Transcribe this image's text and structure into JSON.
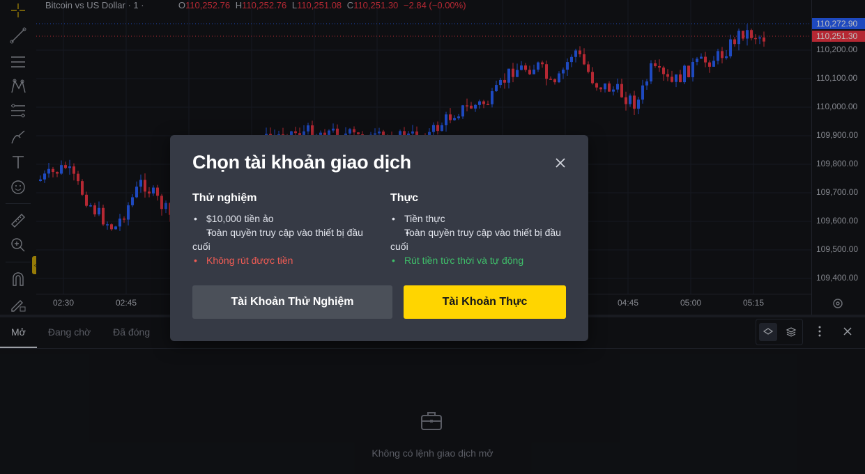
{
  "chart": {
    "symbol": "Bitcoin vs US Dollar · 1 ·",
    "ohlc": [
      {
        "key": "O",
        "value": "110,252.76"
      },
      {
        "key": "H",
        "value": "110,252.76"
      },
      {
        "key": "L",
        "value": "110,251.08"
      },
      {
        "key": "C",
        "value": "110,251.30"
      }
    ],
    "change": "−2.84 (−0.00%)",
    "price_ticks": [
      "110,200.00",
      "110,100.00",
      "110,000.00",
      "109,900.00",
      "109,800.00",
      "109,700.00",
      "109,600.00",
      "109,500.00",
      "109,400.00"
    ],
    "price_tag_top": "110,272.90",
    "price_tag_last": "110,251.30",
    "time_ticks": [
      "02:30",
      "02:45",
      "04:45",
      "05:00",
      "05:15"
    ],
    "colors": {
      "up": "#2962ff",
      "down": "#f23645",
      "tag_top": "#2962ff",
      "tag_last": "#f23645"
    }
  },
  "bottom_panel": {
    "tabs": [
      {
        "label": "Mở",
        "active": true
      },
      {
        "label": "Đang chờ",
        "active": false
      },
      {
        "label": "Đã đóng",
        "active": false
      }
    ],
    "empty_text": "Không có lệnh giao dịch mở"
  },
  "modal": {
    "title": "Chọn tài khoản giao dịch",
    "demo": {
      "title": "Thử nghiệm",
      "items": [
        "$10,000 tiền ảo",
        "Toàn quyền truy cập vào thiết bị đầu cuối",
        "Không rút được tiền"
      ],
      "button": "Tài Khoản Thử Nghiệm"
    },
    "real": {
      "title": "Thực",
      "items": [
        "Tiền thực",
        "Toàn quyền truy cập vào thiết bị đầu cuối",
        "Rút tiền tức thời và tự động"
      ],
      "button": "Tài Khoản Thực"
    },
    "colors": {
      "accent": "#ffd500",
      "negative": "#f25c54",
      "positive": "#3fbf6a"
    }
  },
  "icons": [
    "crosshair-icon",
    "trend-line-icon",
    "horizontal-lines-icon",
    "pattern-icon",
    "fib-icon",
    "brush-icon",
    "text-icon",
    "emoji-icon",
    "ruler-icon",
    "zoom-icon",
    "magnet-icon",
    "lock-pencil-icon",
    "settings-icon",
    "layers-icon",
    "stack-icon",
    "more-icon",
    "close-icon",
    "briefcase-icon"
  ]
}
